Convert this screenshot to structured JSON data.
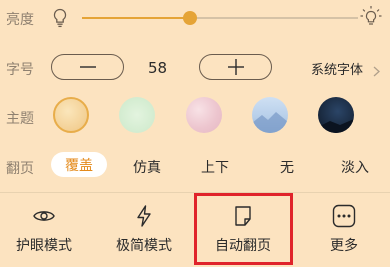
{
  "brightness": {
    "label": "亮度",
    "level": 0.39
  },
  "font_size": {
    "label": "字号",
    "decrease": "—",
    "increase": "+",
    "value": "58",
    "font_link": "系统字体"
  },
  "theme": {
    "label": "主题",
    "swatches": [
      {
        "name": "warm-yellow",
        "color": "#f6d9a2",
        "selected": true
      },
      {
        "name": "mint-green",
        "color": "#d6efd4"
      },
      {
        "name": "pink-watercolor",
        "color": "#f1cfd6"
      },
      {
        "name": "blue-landscape",
        "color": "#bad2ea"
      },
      {
        "name": "night-sky",
        "color": "#1a2a40"
      }
    ]
  },
  "page_turn": {
    "label": "翻页",
    "options": [
      {
        "label": "覆盖",
        "active": true
      },
      {
        "label": "仿真"
      },
      {
        "label": "上下"
      },
      {
        "label": "无"
      },
      {
        "label": "淡入"
      }
    ]
  },
  "toolbar": {
    "eye_label": "护眼模式",
    "minimal_label": "极简模式",
    "autopage_label": "自动翻页",
    "more_label": "更多"
  },
  "colors": {
    "accent": "#e5a437",
    "active_text": "#e48a1b",
    "highlight": "#e0242b",
    "background": "#fce3c0"
  },
  "icons": [
    "bulb-icon",
    "bulb-bright-icon",
    "minus-icon",
    "plus-icon",
    "chevron-right-icon",
    "eye-icon",
    "lightning-icon",
    "note-icon",
    "more-dots-icon"
  ]
}
